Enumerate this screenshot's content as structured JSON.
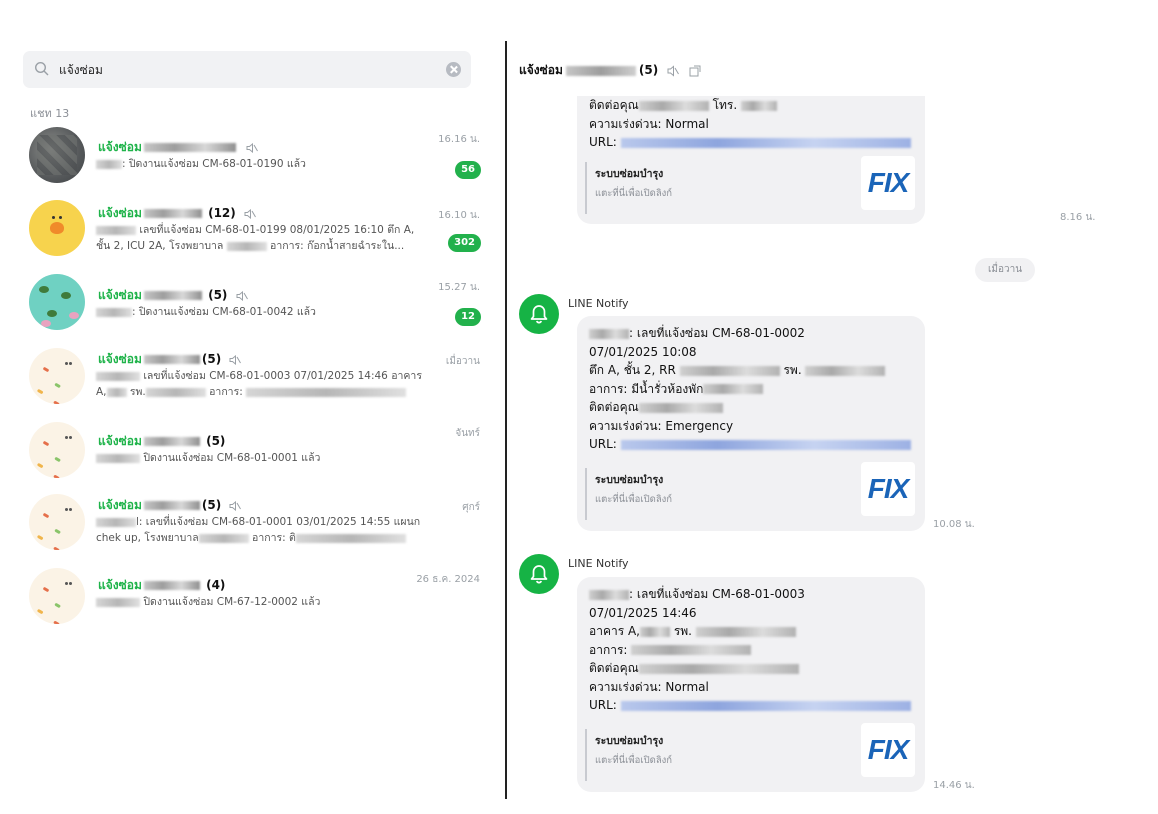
{
  "search": {
    "value": "แจ้งซ่อม"
  },
  "section_label": "แชท 13",
  "chats": [
    {
      "name": "แจ้งซ่อม",
      "count": "",
      "muted": true,
      "preview_1": ": ปิดงานแจ้งซ่อม CM-68-01-0190 แล้ว",
      "preview_2": "",
      "time": "16.16 น.",
      "unread": "56"
    },
    {
      "name": "แจ้งซ่อม",
      "count": "(12)",
      "muted": true,
      "preview_1": "เลขที่แจ้งซ่อม CM-68-01-0199  08/01/2025 16:10  ตึก A,",
      "preview_2": "ชั้น 2, ICU 2A, โรงพยาบาล",
      "preview_3": "อาการ: ก๊อกน้ำสายฉำระใน...",
      "time": "16.10 น.",
      "unread": "302"
    },
    {
      "name": "แจ้งซ่อม",
      "count": "(5)",
      "muted": true,
      "preview_1": ": ปิดงานแจ้งซ่อม CM-68-01-0042 แล้ว",
      "preview_2": "",
      "time": "15.27 น.",
      "unread": "12"
    },
    {
      "name": "แจ้งซ่อม",
      "count": "(5)",
      "muted": true,
      "preview_1": "เลขที่แจ้งซ่อม CM-68-01-0003  07/01/2025 14:46  อาคาร",
      "preview_2": "A,",
      "preview_3": "รพ.",
      "preview_4": "อาการ:",
      "time": "เมื่อวาน",
      "unread": ""
    },
    {
      "name": "แจ้งซ่อม",
      "count": "(5)",
      "muted": false,
      "preview_1": "ปิดงานแจ้งซ่อม CM-68-01-0001 แล้ว",
      "preview_2": "",
      "time": "จันทร์",
      "unread": ""
    },
    {
      "name": "แจ้งซ่อม",
      "count": "(5)",
      "muted": true,
      "preview_1": "l: เลขที่แจ้งซ่อม CM-68-01-0001  03/01/2025 14:55  แผนก",
      "preview_2": "chek up, โรงพยาบาล",
      "preview_3": "อาการ: ติ",
      "time": "ศุกร์",
      "unread": ""
    },
    {
      "name": "แจ้งซ่อม",
      "count": "(4)",
      "muted": false,
      "preview_1": "ปิดงานแจ้งซ่อม CM-67-12-0002 แล้ว",
      "preview_2": "",
      "time": "26 ธ.ค. 2024",
      "unread": ""
    }
  ],
  "room": {
    "title": "แจ้งซ่อม",
    "count": "(5)"
  },
  "messages": {
    "m0": {
      "line_contact": "ติดต่อคุณ",
      "line_phone": "โทร.",
      "line_urgency": "ความเร่งด่วน: Normal",
      "line_url": "URL:",
      "card_title": "ระบบซ่อมบำรุง",
      "card_sub": "แตะที่นี่เพื่อเปิดลิงก์",
      "logo": "FIX",
      "time": "8.16 น."
    },
    "date_divider": "เมื่อวาน",
    "m1": {
      "sender": "LINE Notify",
      "line_1": ": เลขที่แจ้งซ่อม CM-68-01-0002",
      "line_2": "07/01/2025 10:08",
      "line_3a": "ตึก A, ชั้น 2, RR",
      "line_3b": "รพ.",
      "line_4": "อาการ: มีน้ำรั่วห้องพัก",
      "line_5": "ติดต่อคุณ",
      "line_urgency": "ความเร่งด่วน: Emergency",
      "line_url": "URL:",
      "card_title": "ระบบซ่อมบำรุง",
      "card_sub": "แตะที่นี่เพื่อเปิดลิงก์",
      "logo": "FIX",
      "time": "10.08 น."
    },
    "m2": {
      "sender": "LINE Notify",
      "line_1": ": เลขที่แจ้งซ่อม CM-68-01-0003",
      "line_2": "07/01/2025 14:46",
      "line_3a": "อาคาร A,",
      "line_3b": "รพ.",
      "line_4": "อาการ:",
      "line_5": "ติดต่อคุณ",
      "line_urgency": "ความเร่งด่วน: Normal",
      "line_url": "URL:",
      "card_title": "ระบบซ่อมบำรุง",
      "card_sub": "แตะที่นี่เพื่อเปิดลิงก์",
      "logo": "FIX",
      "time": "14.46 น."
    }
  },
  "colors": {
    "accent_green": "#1fb34a",
    "badge_green": "#22b14c",
    "link_blue": "#1a64b8"
  }
}
